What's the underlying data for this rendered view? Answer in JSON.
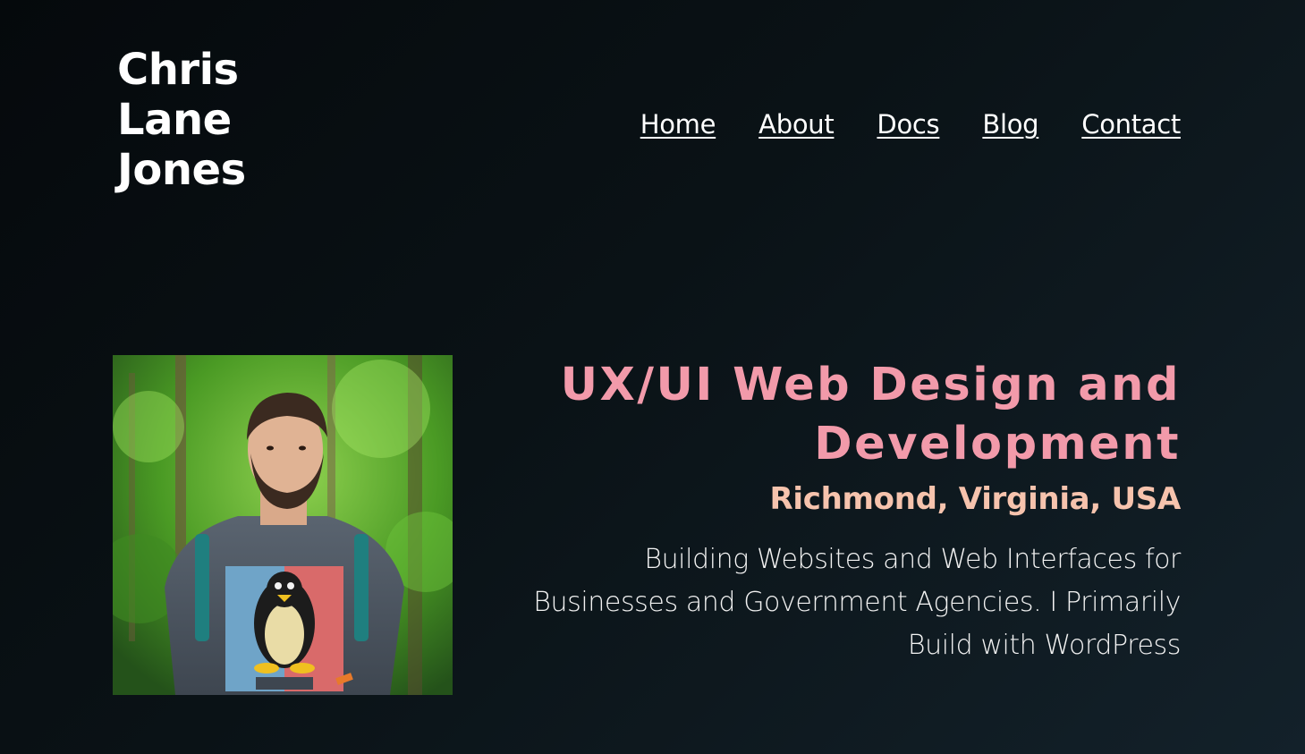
{
  "site": {
    "title_lines": [
      "Chris",
      "Lane",
      "Jones"
    ]
  },
  "nav": {
    "items": [
      {
        "label": "Home"
      },
      {
        "label": "About"
      },
      {
        "label": "Docs"
      },
      {
        "label": "Blog"
      },
      {
        "label": "Contact"
      }
    ]
  },
  "hero": {
    "photo_alt": "Portrait of Chris Lane Jones in a forest wearing a Linux penguin t-shirt",
    "title": "UX/UI Web Design and Development",
    "location": "Richmond, Virginia, USA",
    "description": "Building Websites and Web Interfaces for Businesses and Government Agencies. I Primarily Build with WordPress"
  },
  "colors": {
    "background_dark": "#05090c",
    "background_light": "#13212a",
    "title_pink": "#f29aaa",
    "location_peach": "#f6c3ad",
    "text_white": "#ffffff"
  }
}
